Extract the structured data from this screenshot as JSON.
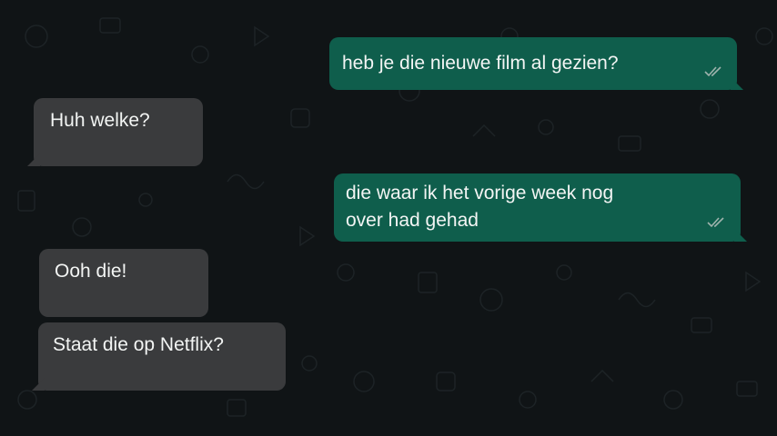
{
  "chat": {
    "colors": {
      "background": "#101416",
      "outgoing_bubble": "#0f5e4c",
      "incoming_bubble": "#3a3b3d",
      "text": "#f3f5f4",
      "ticks": "#9fb3ad"
    },
    "messages": [
      {
        "direction": "outgoing",
        "text": "heb je die nieuwe film al gezien?",
        "status_icon": "double-check-icon"
      },
      {
        "direction": "incoming",
        "text": "Huh welke?"
      },
      {
        "direction": "outgoing",
        "line1": "die waar ik het vorige week nog",
        "line2": "over had gehad",
        "status_icon": "double-check-icon"
      },
      {
        "direction": "incoming",
        "text": "Ooh die!"
      },
      {
        "direction": "incoming",
        "text": "Staat die op Netflix?"
      }
    ]
  }
}
